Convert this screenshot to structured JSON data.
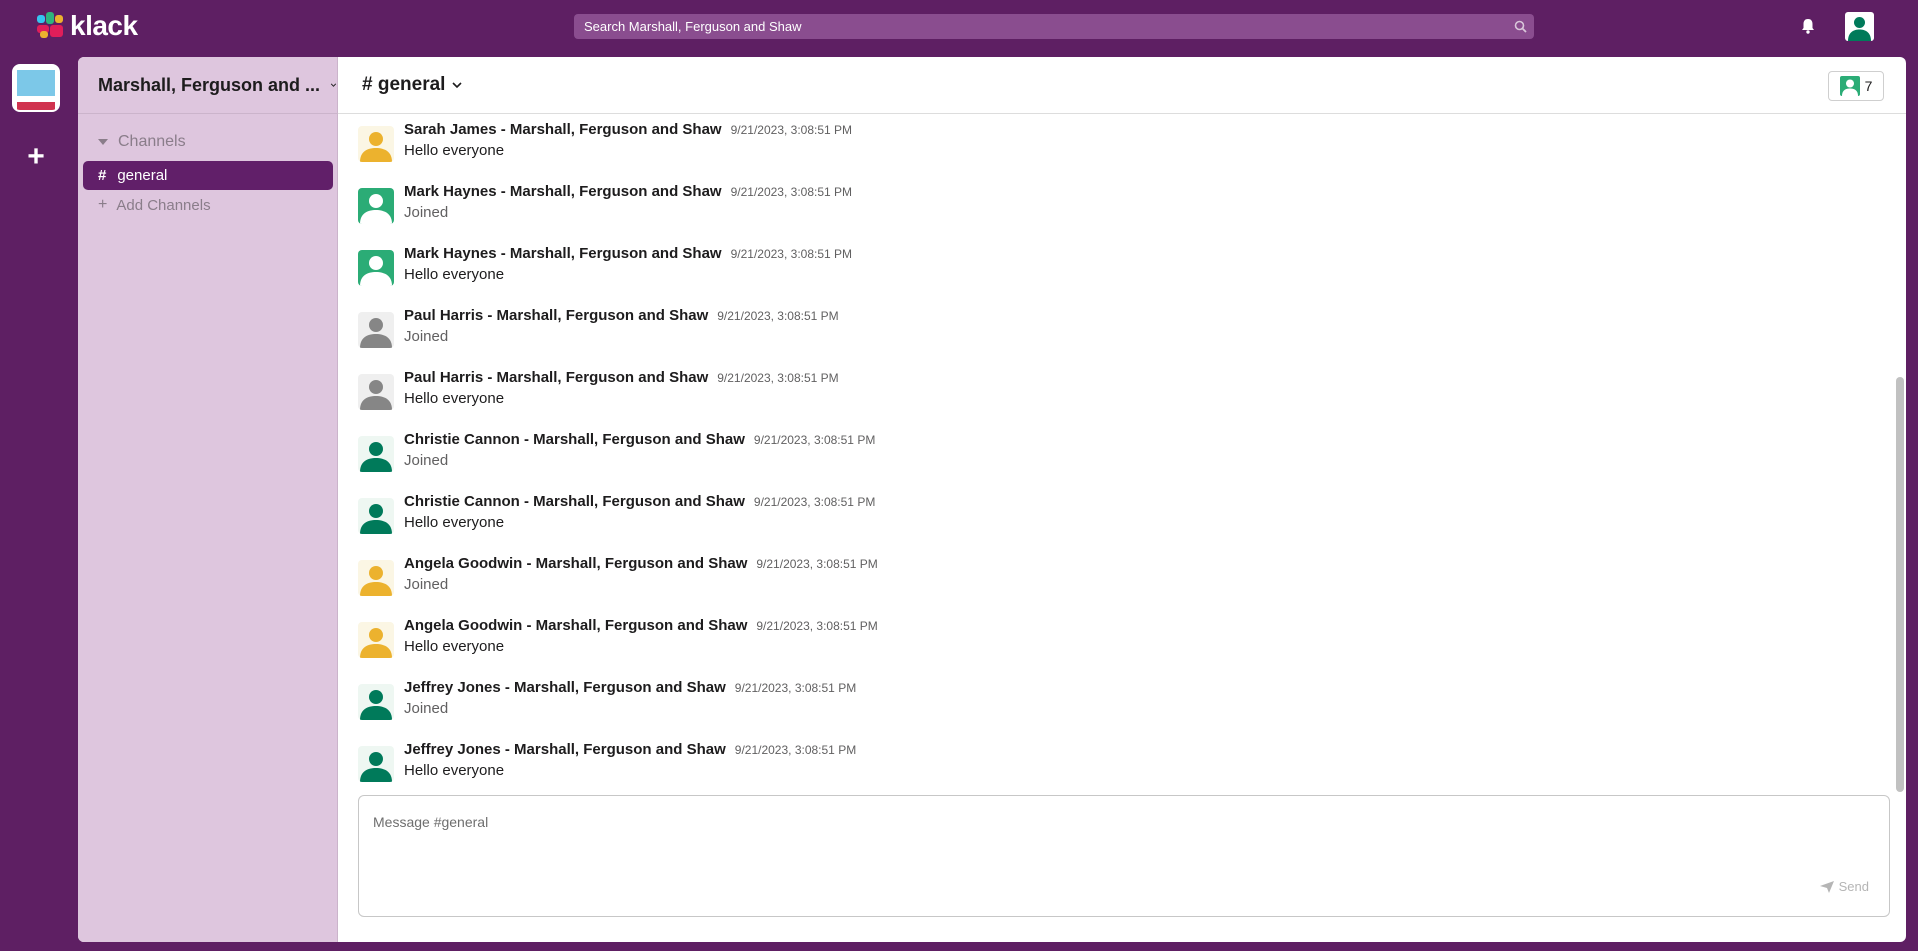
{
  "app": {
    "name": "klack"
  },
  "search": {
    "placeholder": "Search Marshall, Ferguson and Shaw"
  },
  "workspace": {
    "name": "Marshall, Ferguson and ..."
  },
  "sidebar": {
    "section_label": "Channels",
    "channels": [
      {
        "hash": "#",
        "label": "general"
      }
    ],
    "add_channels_label": "Add Channels"
  },
  "channel": {
    "title": "# general",
    "member_count": "7"
  },
  "messages": [
    {
      "name": "Sarah James - Marshall, Ferguson and Shaw",
      "time": "9/21/2023, 3:08:51 PM",
      "text": "Hello everyone",
      "muted": false,
      "avatar_bg": "#fbf6e4",
      "avatar_fg": "#ecb22e"
    },
    {
      "name": "Mark Haynes - Marshall, Ferguson and Shaw",
      "time": "9/21/2023, 3:08:51 PM",
      "text": "Joined",
      "muted": true,
      "avatar_bg": "#2bac76",
      "avatar_fg": "#ffffff"
    },
    {
      "name": "Mark Haynes - Marshall, Ferguson and Shaw",
      "time": "9/21/2023, 3:08:51 PM",
      "text": "Hello everyone",
      "muted": false,
      "avatar_bg": "#2bac76",
      "avatar_fg": "#ffffff"
    },
    {
      "name": "Paul Harris - Marshall, Ferguson and Shaw",
      "time": "9/21/2023, 3:08:51 PM",
      "text": "Joined",
      "muted": true,
      "avatar_bg": "#efefef",
      "avatar_fg": "#868686"
    },
    {
      "name": "Paul Harris - Marshall, Ferguson and Shaw",
      "time": "9/21/2023, 3:08:51 PM",
      "text": "Hello everyone",
      "muted": false,
      "avatar_bg": "#efefef",
      "avatar_fg": "#868686"
    },
    {
      "name": "Christie Cannon - Marshall, Ferguson and Shaw",
      "time": "9/21/2023, 3:08:51 PM",
      "text": "Joined",
      "muted": true,
      "avatar_bg": "#eef7f2",
      "avatar_fg": "#007a5a"
    },
    {
      "name": "Christie Cannon - Marshall, Ferguson and Shaw",
      "time": "9/21/2023, 3:08:51 PM",
      "text": "Hello everyone",
      "muted": false,
      "avatar_bg": "#eef7f2",
      "avatar_fg": "#007a5a"
    },
    {
      "name": "Angela Goodwin - Marshall, Ferguson and Shaw",
      "time": "9/21/2023, 3:08:51 PM",
      "text": "Joined",
      "muted": true,
      "avatar_bg": "#fbf6e4",
      "avatar_fg": "#ecb22e"
    },
    {
      "name": "Angela Goodwin - Marshall, Ferguson and Shaw",
      "time": "9/21/2023, 3:08:51 PM",
      "text": "Hello everyone",
      "muted": false,
      "avatar_bg": "#fbf6e4",
      "avatar_fg": "#ecb22e"
    },
    {
      "name": "Jeffrey Jones - Marshall, Ferguson and Shaw",
      "time": "9/21/2023, 3:08:51 PM",
      "text": "Joined",
      "muted": true,
      "avatar_bg": "#eef7f2",
      "avatar_fg": "#007a5a"
    },
    {
      "name": "Jeffrey Jones - Marshall, Ferguson and Shaw",
      "time": "9/21/2023, 3:08:51 PM",
      "text": "Hello everyone",
      "muted": false,
      "avatar_bg": "#eef7f2",
      "avatar_fg": "#007a5a"
    }
  ],
  "composer": {
    "placeholder": "Message #general",
    "send_label": "Send"
  },
  "colors": {
    "brand": "#5e1f63",
    "active_channel": "#611f69",
    "sidebar": "#dec6de"
  },
  "icons": {
    "search": "search-icon",
    "bell": "bell-icon",
    "avatar": "user-avatar-icon",
    "add_workspace": "plus-icon",
    "chevron": "chevron-down-icon",
    "send": "paper-plane-icon"
  }
}
